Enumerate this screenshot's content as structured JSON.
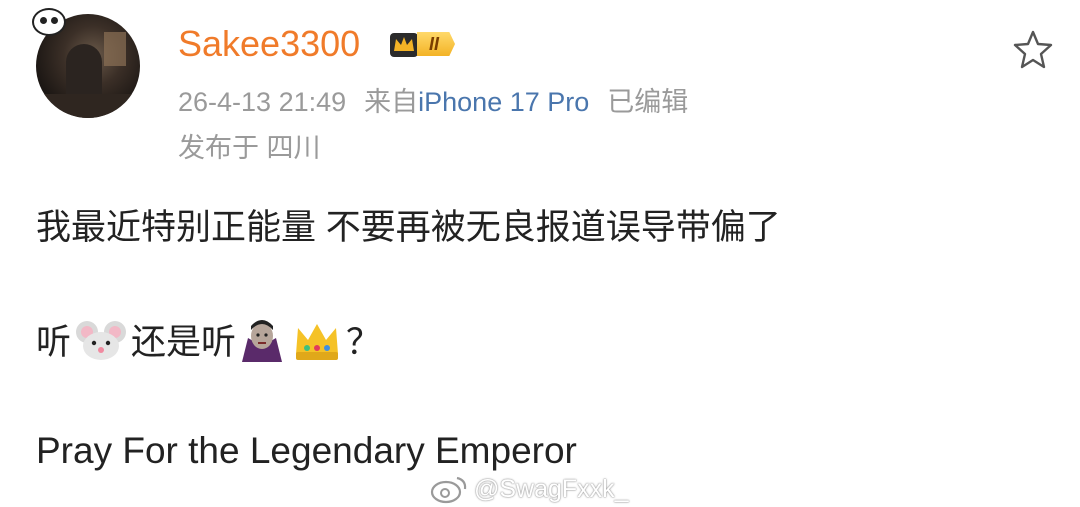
{
  "post": {
    "username": "Sakee3300",
    "vip_level": "II",
    "timestamp": "26-4-13 21:49",
    "source_prefix": "来自",
    "device": "iPhone 17 Pro",
    "edited": "已编辑",
    "location": "发布于 四川",
    "line1": "我最近特别正能量 不要再被无良报道误导带偏了",
    "line2_a": "听",
    "line2_b": "还是听",
    "line2_end": "？",
    "line3": "Pray For the Legendary Emperor"
  },
  "watermark": {
    "text": "@SwagFxxk_"
  },
  "icons": {
    "favorite": "star-outline-icon",
    "vip": "crown-icon",
    "emoji_1": "mouse-face-emoji",
    "emoji_2": "vampire-emoji",
    "emoji_3": "crown-emoji",
    "watermark": "weibo-logo-icon"
  },
  "colors": {
    "username": "#f07b2a",
    "meta": "#9a9a9a",
    "device_link": "#4a76ad",
    "text": "#222222"
  }
}
